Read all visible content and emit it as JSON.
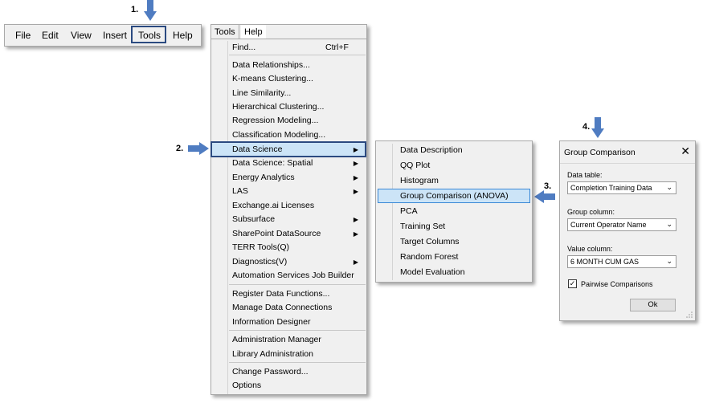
{
  "steps": {
    "s1": "1.",
    "s2": "2.",
    "s3": "3.",
    "s4": "4."
  },
  "menubar": {
    "items": [
      "File",
      "Edit",
      "View",
      "Insert",
      "Tools",
      "Help"
    ]
  },
  "tools_menu": {
    "tabs": [
      "Tools",
      "Help"
    ],
    "find": {
      "label": "Find...",
      "shortcut": "Ctrl+F"
    },
    "items": [
      "Data Relationships...",
      "K-means Clustering...",
      "Line Similarity...",
      "Hierarchical Clustering...",
      "Regression Modeling...",
      "Classification Modeling...",
      "Data Science",
      "Data Science: Spatial",
      "Energy Analytics",
      "LAS",
      "Exchange.ai Licenses",
      "Subsurface",
      "SharePoint DataSource",
      "TERR Tools(Q)",
      "Diagnostics(V)",
      "Automation Services Job Builder",
      "Register Data Functions...",
      "Manage Data Connections",
      "Information Designer",
      "Administration Manager",
      "Library Administration",
      "Change Password...",
      "Options"
    ]
  },
  "submenu": {
    "items": [
      "Data Description",
      "QQ Plot",
      "Histogram",
      "Group Comparison (ANOVA)",
      "PCA",
      "Training Set",
      "Target Columns",
      "Random Forest",
      "Model Evaluation"
    ]
  },
  "dialog": {
    "title": "Group Comparison",
    "data_table_label": "Data table:",
    "data_table_value": "Completion Training Data",
    "group_column_label": "Group column:",
    "group_column_value": "Current Operator Name",
    "value_column_label": "Value column:",
    "value_column_value": "6 MONTH CUM GAS",
    "pairwise_label": "Pairwise Comparisons",
    "ok_label": "Ok"
  },
  "icons": {
    "close": "close-icon",
    "chevron": "chevron-down-icon",
    "submenu": "submenu-arrow-icon",
    "check": "check-icon"
  },
  "colors": {
    "arrow": "#4f7cc1",
    "highlight_border": "#2b4a80",
    "selection": "#cce4f7"
  }
}
